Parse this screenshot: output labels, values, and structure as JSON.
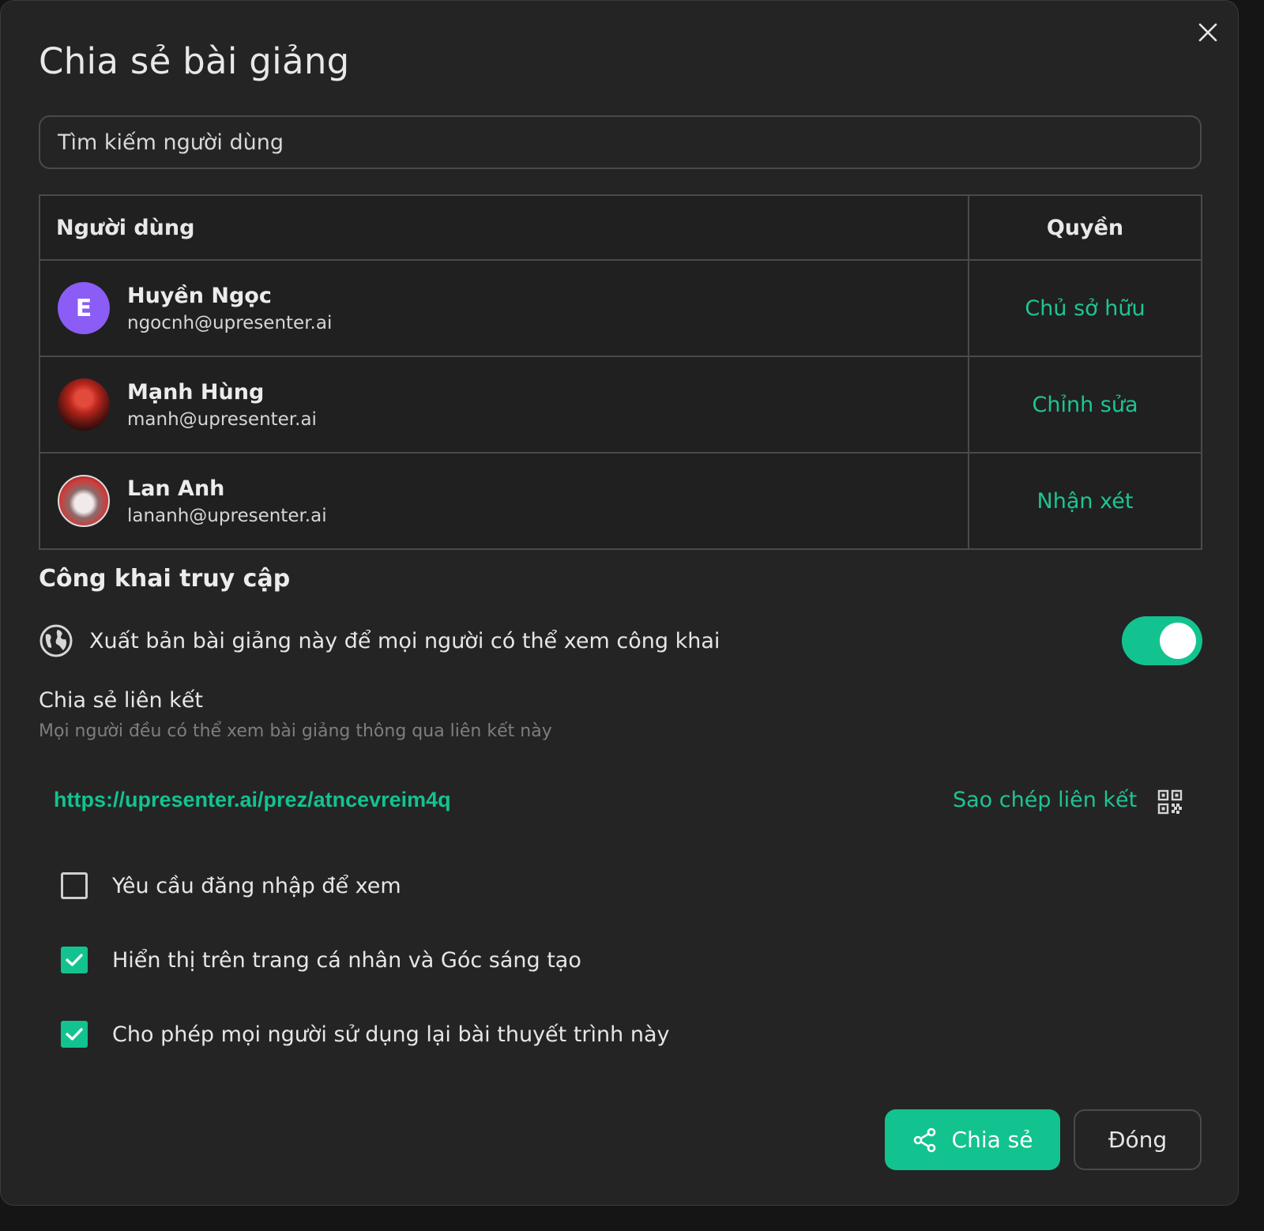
{
  "dialog": {
    "title": "Chia sẻ bài giảng",
    "close_icon": "close-icon"
  },
  "search": {
    "placeholder": "Tìm kiếm người dùng"
  },
  "table": {
    "headers": {
      "user": "Người dùng",
      "permission": "Quyền"
    },
    "rows": [
      {
        "name": "Huyền Ngọc",
        "email": "ngocnh@upresenter.ai",
        "avatar_letter": "E",
        "avatar_color": "#8b5cf6",
        "permission": "Chủ sở hữu"
      },
      {
        "name": "Mạnh Hùng",
        "email": "manh@upresenter.ai",
        "avatar_letter": "",
        "permission": "Chỉnh sửa"
      },
      {
        "name": "Lan Anh",
        "email": "lananh@upresenter.ai",
        "avatar_letter": "",
        "permission": "Nhận xét"
      }
    ]
  },
  "public_access": {
    "title": "Công khai truy cập",
    "publish_label": "Xuất bản bài giảng này để mọi người có thể xem công khai",
    "publish_enabled": true,
    "globe_icon": "globe-icon"
  },
  "share_link": {
    "title": "Chia sẻ liên kết",
    "subtitle": "Mọi người đều có thể xem bài giảng thông qua liên kết này",
    "url": "https://upresenter.ai/prez/atncevreim4q",
    "copy_label": "Sao chép liên kết",
    "qr_icon": "qr-code-icon"
  },
  "options": [
    {
      "label": "Yêu cầu đăng nhập để xem",
      "checked": false
    },
    {
      "label": "Hiển thị trên trang cá nhân và Góc sáng tạo",
      "checked": true
    },
    {
      "label": "Cho phép mọi người sử dụng lại bài thuyết trình này",
      "checked": true
    }
  ],
  "footer": {
    "share_label": "Chia sẻ",
    "close_label": "Đóng"
  },
  "colors": {
    "accent": "#12c38f",
    "background": "#242424",
    "border": "#4a4a4a"
  }
}
